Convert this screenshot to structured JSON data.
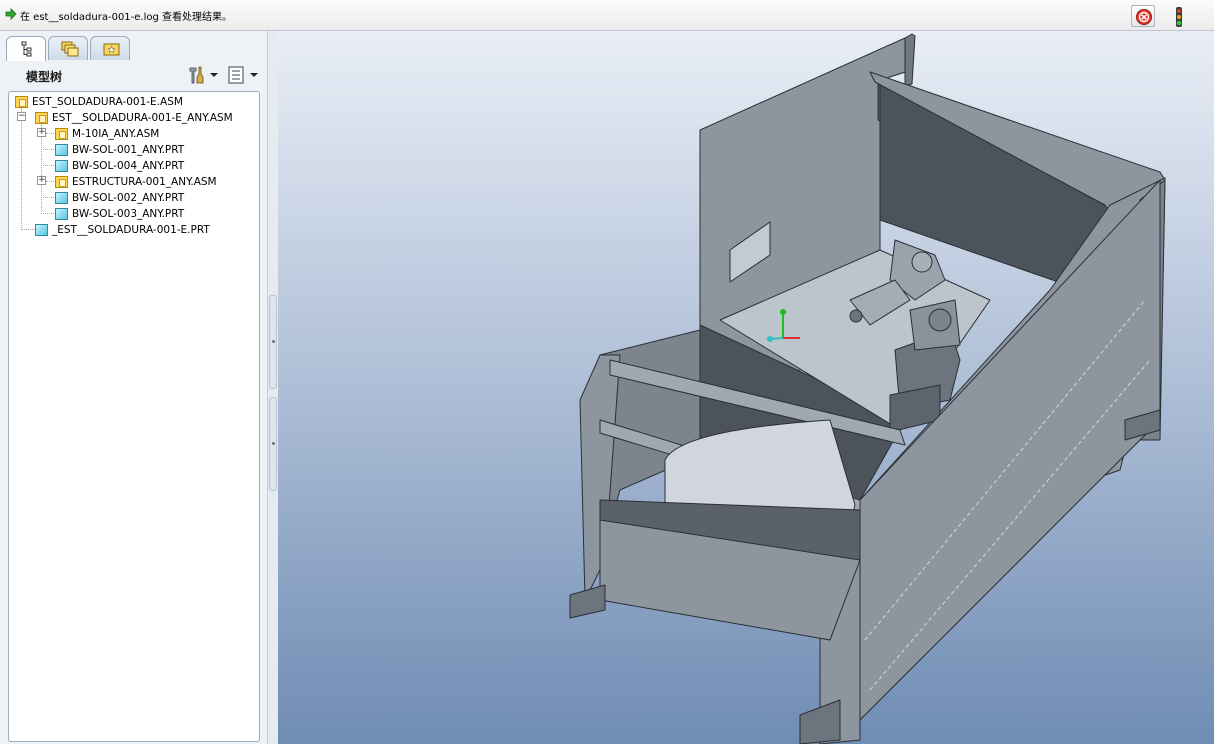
{
  "status_bar": {
    "message": "在 est__soldadura-001-e.log 查看处理结果。",
    "icons": [
      "green-arrow-icon",
      "stop-icon",
      "traffic-light-icon"
    ]
  },
  "navigator": {
    "tabs": [
      {
        "name": "model-tree-tab",
        "icon": "model-tree-icon"
      },
      {
        "name": "folder-browser-tab",
        "icon": "folders-icon"
      },
      {
        "name": "favorites-tab",
        "icon": "favorites-icon"
      }
    ],
    "title": "模型树",
    "settings_icon": "tools-icon",
    "show_icon": "list-icon",
    "tree": [
      {
        "label": "EST_SOLDADURA-001-E.ASM",
        "type": "asm",
        "level": 0
      },
      {
        "label": "EST__SOLDADURA-001-E_ANY.ASM",
        "type": "asm",
        "level": 1,
        "expander": "minus"
      },
      {
        "label": "M-10IA_ANY.ASM",
        "type": "asm",
        "level": 2,
        "expander": "plus"
      },
      {
        "label": "BW-SOL-001_ANY.PRT",
        "type": "prt",
        "level": 2
      },
      {
        "label": "BW-SOL-004_ANY.PRT",
        "type": "prt",
        "level": 2
      },
      {
        "label": "ESTRUCTURA-001_ANY.ASM",
        "type": "asm",
        "level": 2,
        "expander": "plus"
      },
      {
        "label": "BW-SOL-002_ANY.PRT",
        "type": "prt",
        "level": 2
      },
      {
        "label": "BW-SOL-003_ANY.PRT",
        "type": "prt",
        "level": 2
      },
      {
        "label": "_EST__SOLDADURA-001-E.PRT",
        "type": "prt",
        "level": 1
      }
    ]
  },
  "graphics": {
    "content": "3d-welding-cell-model",
    "colors": {
      "body": "#8d959e",
      "dark": "#4c535b",
      "light": "#bcc4cc",
      "edge": "#2a2f35",
      "turntable": "#d0d6dc"
    }
  }
}
